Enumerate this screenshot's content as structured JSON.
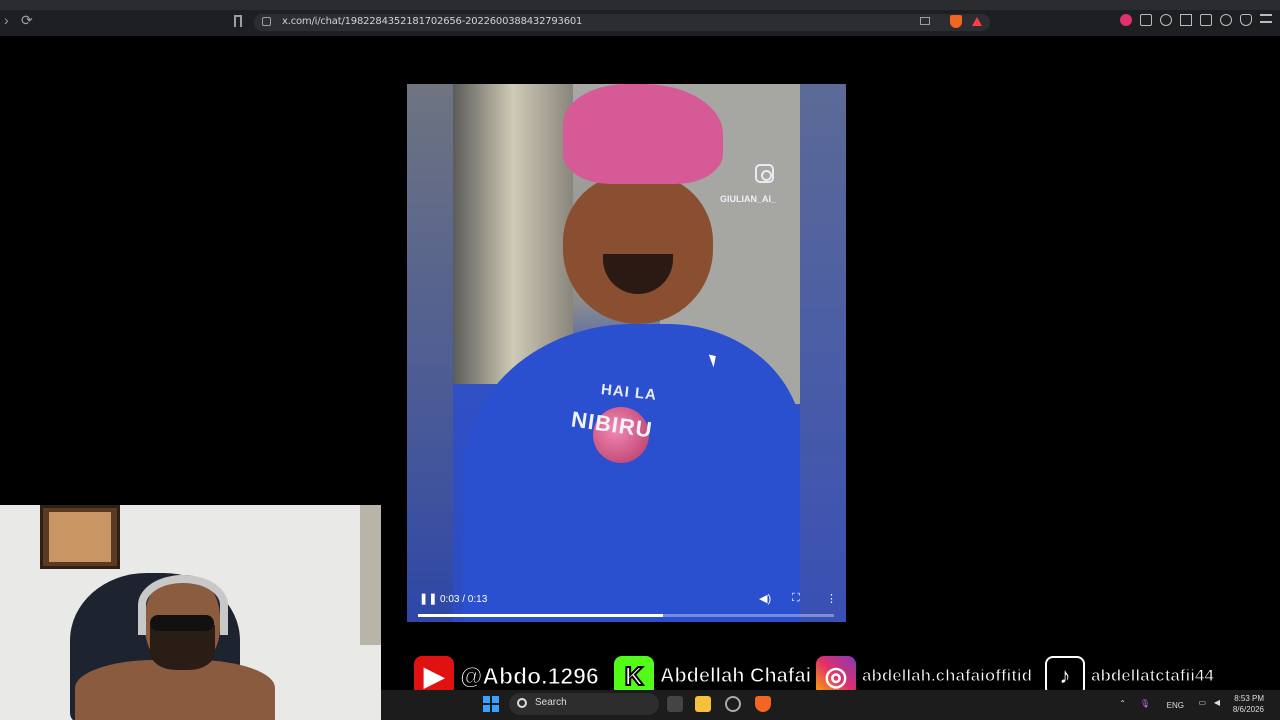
{
  "browser": {
    "url": "x.com/i/chat/1982284352181702656-2022600388432793601"
  },
  "video": {
    "overlay_handle": "GIULIAN_AI_",
    "shirt_line1": "HAI LA",
    "shirt_line2": "NIBIRU",
    "time": "0:03 / 0:13",
    "progress": 0.59
  },
  "social": {
    "youtube": "@Abdo.1296",
    "kick": "Abdellah Chafai",
    "instagram": "abdellah.chafaioffitid",
    "tiktok": "abdellatctafii44"
  },
  "taskbar": {
    "search_placeholder": "Search",
    "language": "ENG",
    "time": "8:53 PM",
    "date": "8/6/2026"
  }
}
